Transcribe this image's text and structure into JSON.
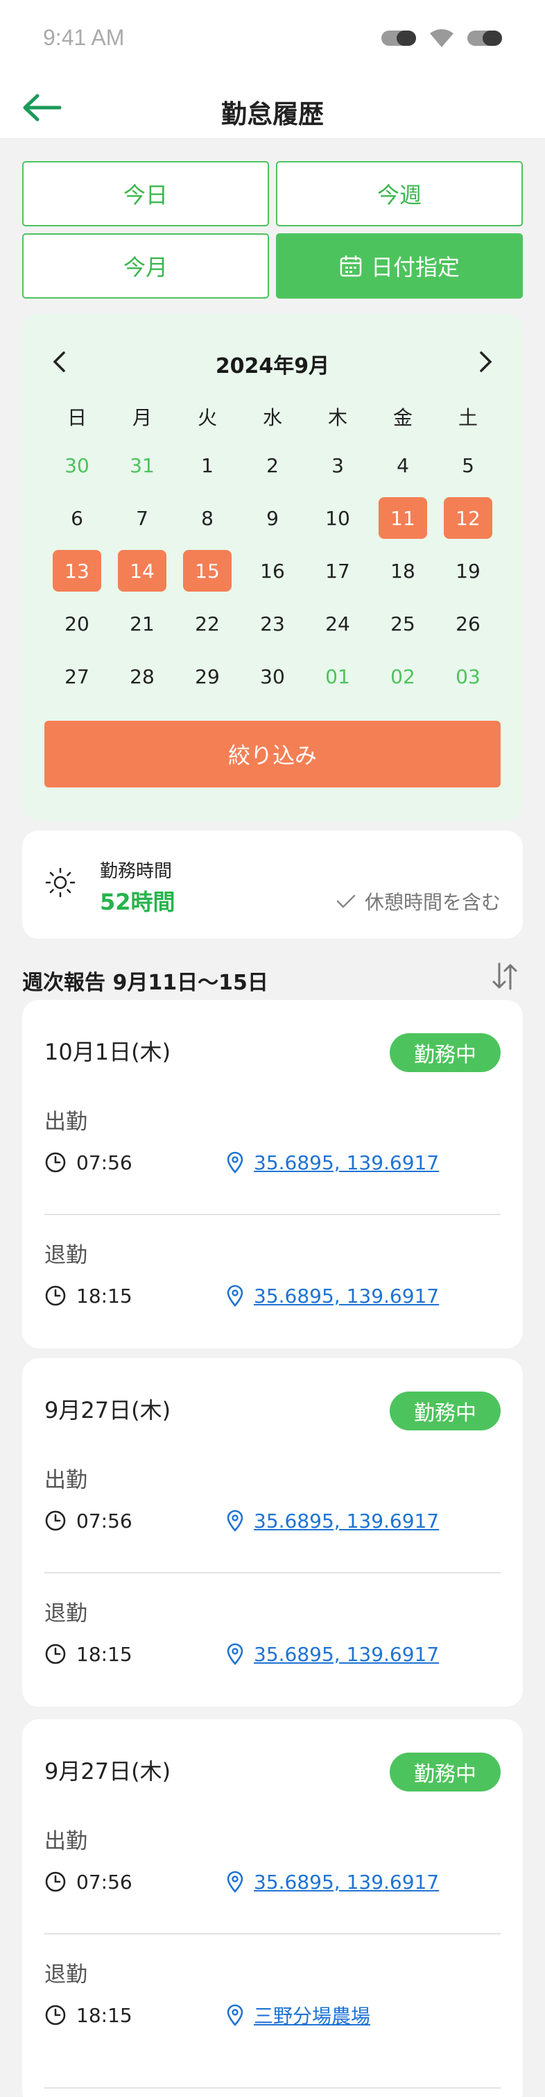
{
  "status_bar": {
    "time": "9:41 AM"
  },
  "header": {
    "title": "勤怠履歴"
  },
  "filters": {
    "today": "今日",
    "this_week": "今週",
    "this_month": "今月",
    "date_select": "日付指定"
  },
  "calendar": {
    "month_label": "2024年9月",
    "weekdays": [
      "日",
      "月",
      "火",
      "水",
      "木",
      "金",
      "土"
    ],
    "days": [
      {
        "d": "30",
        "muted": true
      },
      {
        "d": "31",
        "muted": true
      },
      {
        "d": "1"
      },
      {
        "d": "2"
      },
      {
        "d": "3"
      },
      {
        "d": "4"
      },
      {
        "d": "5"
      },
      {
        "d": "6"
      },
      {
        "d": "7"
      },
      {
        "d": "8"
      },
      {
        "d": "9"
      },
      {
        "d": "10"
      },
      {
        "d": "11",
        "selected": true
      },
      {
        "d": "12",
        "selected": true
      },
      {
        "d": "13",
        "selected": true
      },
      {
        "d": "14",
        "selected": true
      },
      {
        "d": "15",
        "selected": true
      },
      {
        "d": "16"
      },
      {
        "d": "17"
      },
      {
        "d": "18"
      },
      {
        "d": "19"
      },
      {
        "d": "20"
      },
      {
        "d": "21"
      },
      {
        "d": "22"
      },
      {
        "d": "23"
      },
      {
        "d": "24"
      },
      {
        "d": "25"
      },
      {
        "d": "26"
      },
      {
        "d": "27"
      },
      {
        "d": "28"
      },
      {
        "d": "29"
      },
      {
        "d": "30"
      },
      {
        "d": "01",
        "muted": true
      },
      {
        "d": "02",
        "muted": true
      },
      {
        "d": "03",
        "muted": true
      }
    ],
    "apply_label": "絞り込み"
  },
  "work_summary": {
    "label": "勤務時間",
    "value": "52時間",
    "break_label": "休憩時間を含む"
  },
  "weekly": {
    "title": "週次報告 9月11日〜15日"
  },
  "labels": {
    "clock_in": "出勤",
    "clock_out": "退勤"
  },
  "records": [
    {
      "date": "10月1日(木)",
      "status": "勤務中",
      "in_time": "07:56",
      "in_location": "35.6895, 139.6917",
      "out_time": "18:15",
      "out_location": "35.6895, 139.6917"
    },
    {
      "date": "9月27日(木)",
      "status": "勤務中",
      "in_time": "07:56",
      "in_location": "35.6895, 139.6917",
      "out_time": "18:15",
      "out_location": "35.6895, 139.6917"
    },
    {
      "date": "9月27日(木)",
      "status": "勤務中",
      "in_time": "07:56",
      "in_location": "35.6895, 139.6917",
      "out_time": "18:15",
      "out_location": "三野分場農場"
    }
  ],
  "colors": {
    "green": "#4dc35d",
    "orange": "#f47f55",
    "calendar_bg": "#e9f7ec",
    "link": "#1f73d3"
  }
}
